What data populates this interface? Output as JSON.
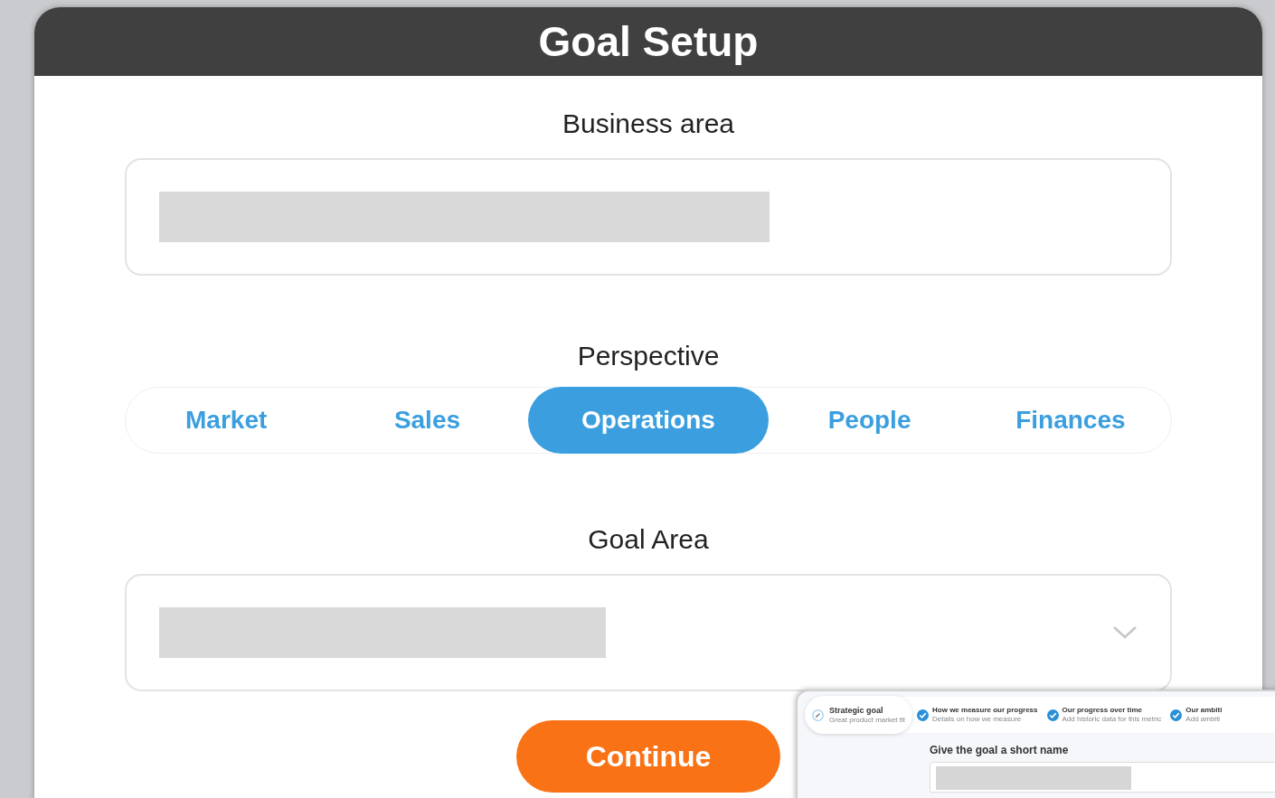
{
  "window": {
    "title": "Goal Setup"
  },
  "business_area": {
    "label": "Business area"
  },
  "perspective": {
    "label": "Perspective",
    "options": [
      {
        "label": "Market",
        "selected": false
      },
      {
        "label": "Sales",
        "selected": false
      },
      {
        "label": "Operations",
        "selected": true
      },
      {
        "label": "People",
        "selected": false
      },
      {
        "label": "Finances",
        "selected": false
      }
    ]
  },
  "goal_area": {
    "label": "Goal Area"
  },
  "continue_button": "Continue",
  "preview": {
    "steps": [
      {
        "title": "Strategic goal",
        "subtitle": "Great product market fit",
        "selected": true,
        "completed": false
      },
      {
        "title": "How we measure our progress",
        "subtitle": "Details on how we measure",
        "selected": false,
        "completed": true
      },
      {
        "title": "Our progress over time",
        "subtitle": "Add historic data for this metric",
        "selected": false,
        "completed": true
      },
      {
        "title": "Our ambiti",
        "subtitle": "Add ambiti",
        "selected": false,
        "completed": true
      }
    ],
    "field_label": "Give the goal a short name"
  }
}
